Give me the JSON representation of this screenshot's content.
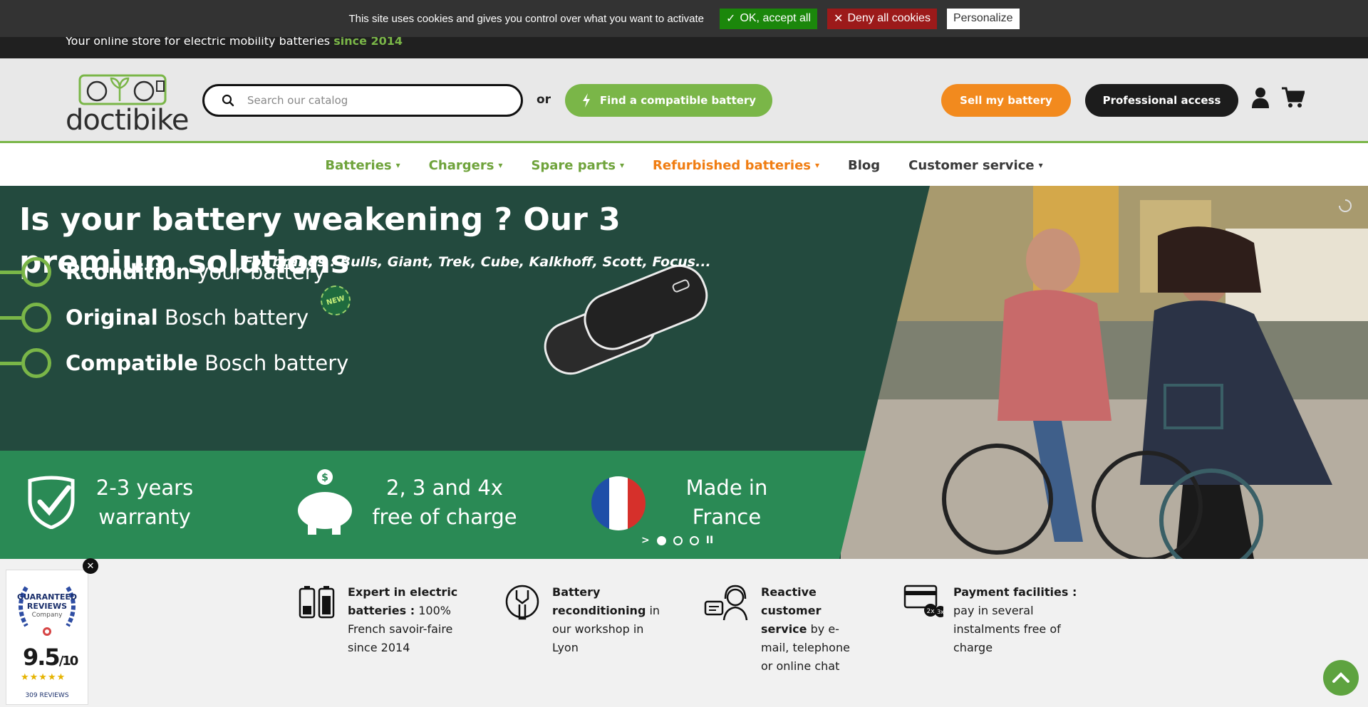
{
  "cookie_bar": {
    "text": "This site uses cookies and gives you control over what you want to activate",
    "accept_label": "OK, accept all",
    "deny_label": "Deny all cookies",
    "personalize_label": "Personalize"
  },
  "top_strip": {
    "tagline": "Your online store for electric mobility batteries ",
    "tagline_highlight": "since 2014"
  },
  "header": {
    "logo_text": "doctibike",
    "search_placeholder": "Search our catalog",
    "or_label": "or",
    "find_battery_label": "Find a compatible battery",
    "sell_label": "Sell my battery",
    "pro_label": "Professional access"
  },
  "nav": {
    "items": [
      {
        "label": "Batteries",
        "dropdown": true
      },
      {
        "label": "Chargers",
        "dropdown": true
      },
      {
        "label": "Spare parts",
        "dropdown": true
      },
      {
        "label": "Refurbished batteries",
        "dropdown": true
      },
      {
        "label": "Blog",
        "dropdown": false
      },
      {
        "label": "Customer service",
        "dropdown": true
      }
    ]
  },
  "hero": {
    "title": "Is your battery weakening ? Our 3 premium solutions",
    "subtitle": "For brands : Bulls, Giant, Trek, Cube, Kalkhoff, Scott, Focus...",
    "options": [
      {
        "bold": "Rcondition",
        "rest": " your battery"
      },
      {
        "bold": "Original",
        "rest": " Bosch battery"
      },
      {
        "bold": "Compatible",
        "rest": " Bosch battery"
      }
    ],
    "new_badge": "NEW",
    "benefits": [
      {
        "line1": "2-3 years",
        "line2": "warranty"
      },
      {
        "line1": "2, 3 and 4x",
        "line2": "free of charge"
      },
      {
        "line1": "Made in",
        "line2": "France"
      }
    ],
    "piggy_symbol": "$",
    "slider": {
      "total": 3,
      "active": 1
    }
  },
  "features": [
    {
      "bold": "Expert in electric batteries :",
      "rest": " 100% French savoir-faire since 2014"
    },
    {
      "bold": "Battery reconditioning",
      "rest": " in our workshop in Lyon"
    },
    {
      "bold": "Reactive customer service",
      "rest": " by e-mail, telephone or online chat"
    },
    {
      "bold": "Payment facilities :",
      "rest": " pay in several instalments free of charge"
    }
  ],
  "payment_badges": [
    "2x",
    "3x"
  ],
  "reviews": {
    "badge_title": "GUARANTEED REVIEWS",
    "badge_sub": "Company",
    "score": "9.5",
    "score_max": "/10",
    "stars": "★★★★★",
    "count": "309 REVIEWS"
  },
  "colors": {
    "brand_green": "#7ab648",
    "orange": "#f28a1e",
    "hero_dark": "#234a3e",
    "hero_band": "#2a8a55"
  }
}
